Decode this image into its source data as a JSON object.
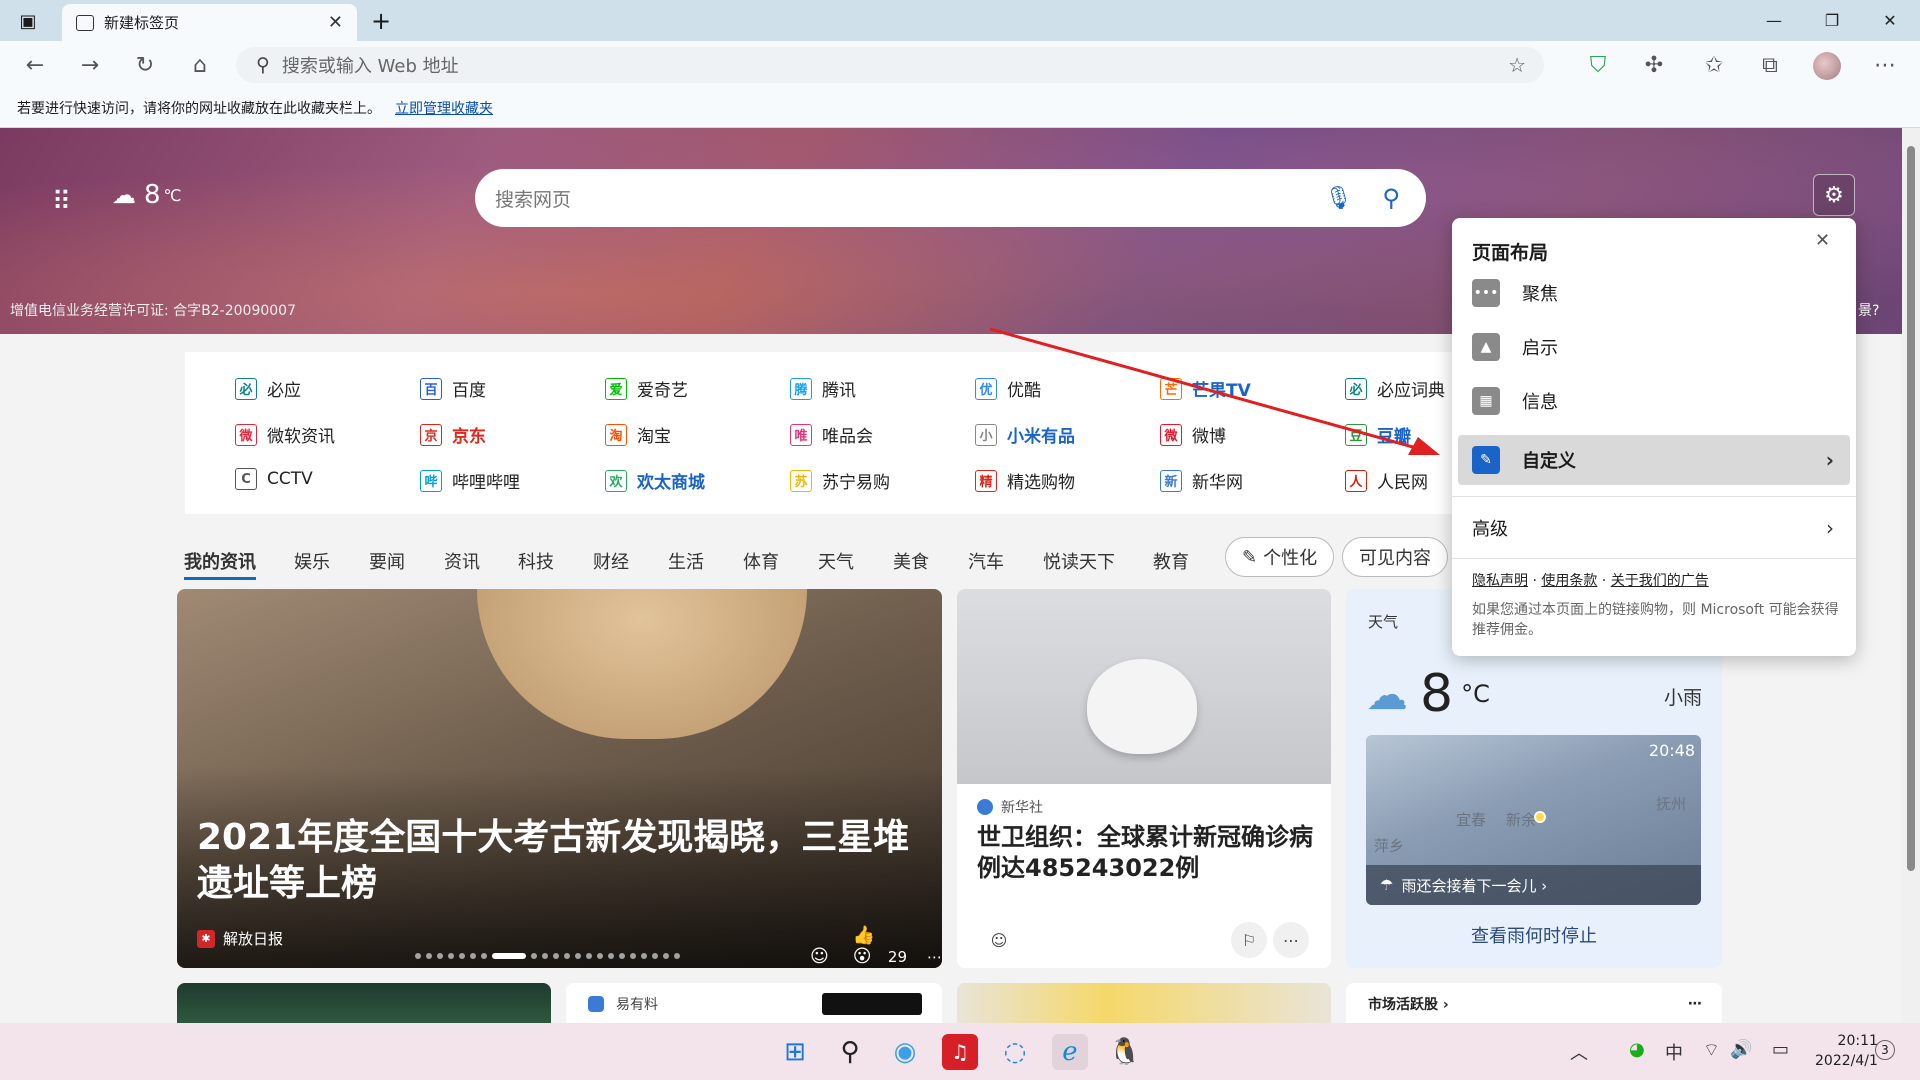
{
  "browser": {
    "tab_title": "新建标签页",
    "address_placeholder": "搜索或输入 Web 地址",
    "favorites_prompt": "若要进行快速访问，请将你的网址收藏放在此收藏夹栏上。",
    "favorites_link": "立即管理收藏夹"
  },
  "hero": {
    "weather_temp": "8",
    "weather_unit": "℃",
    "search_placeholder": "搜索网页",
    "license": "增值电信业务经营许可证: 合字B2-20090007",
    "tail_text": "景?"
  },
  "quick_links": [
    {
      "label": "必应",
      "icon": "bing-icon",
      "color": "#0c8484"
    },
    {
      "label": "百度",
      "icon": "baidu-icon",
      "color": "#2b5dd6"
    },
    {
      "label": "爱奇艺",
      "icon": "iqiyi-icon",
      "color": "#00be06"
    },
    {
      "label": "腾讯",
      "icon": "tencent-icon",
      "color": "#19a0e6"
    },
    {
      "label": "优酷",
      "icon": "youku-icon",
      "color": "#2d8bff"
    },
    {
      "label": "芒果TV",
      "icon": "mgtv-icon",
      "color": "#ff6a00"
    },
    {
      "label": "必应词典",
      "icon": "bing-dict-icon",
      "color": "#0c8484"
    },
    {
      "label": "微软资讯",
      "icon": "msn-icon",
      "color": "#e3273d"
    },
    {
      "label": "京东",
      "icon": "jd-icon",
      "color": "#e1251b"
    },
    {
      "label": "淘宝",
      "icon": "taobao-icon",
      "color": "#ff5000"
    },
    {
      "label": "唯品会",
      "icon": "vip-icon",
      "color": "#e7337a"
    },
    {
      "label": "小米有品",
      "icon": "youpin-icon",
      "color": "#888888"
    },
    {
      "label": "微博",
      "icon": "weibo-icon",
      "color": "#e6162d"
    },
    {
      "label": "豆瓣",
      "icon": "douban-icon",
      "color": "#2e963d"
    },
    {
      "label": "CCTV",
      "icon": "cctv-icon",
      "color": "#555555"
    },
    {
      "label": "哔哩哔哩",
      "icon": "bilibili-icon",
      "color": "#00a1d6"
    },
    {
      "label": "欢太商城",
      "icon": "heytap-icon",
      "color": "#27ae60"
    },
    {
      "label": "苏宁易购",
      "icon": "suning-icon",
      "color": "#f7b500"
    },
    {
      "label": "精选购物",
      "icon": "shopping-icon",
      "color": "#e1251b"
    },
    {
      "label": "新华网",
      "icon": "xinhua-icon",
      "color": "#3a7bd5"
    },
    {
      "label": "人民网",
      "icon": "people-icon",
      "color": "#d81e06"
    }
  ],
  "nav_tabs": [
    "我的资讯",
    "娱乐",
    "要闻",
    "资讯",
    "科技",
    "财经",
    "生活",
    "体育",
    "天气",
    "美食",
    "汽车",
    "悦读天下",
    "教育"
  ],
  "nav_pills": {
    "personalize": "个性化",
    "visible": "可见内容"
  },
  "feature": {
    "title": "2021年度全国十大考古新发现揭晓，三星堆遗址等上榜",
    "source": "解放日报",
    "reactions": "29"
  },
  "news2": {
    "source": "新华社",
    "title": "世卫组织：全球累计新冠确诊病例达485243022例"
  },
  "weather_card": {
    "label": "天气",
    "temp": "8",
    "unit": "°C",
    "condition": "小雨",
    "map_time": "20:48",
    "map_city1": "宜春",
    "map_city2": "新余",
    "map_city3": "抚州",
    "map_city4": "萍乡",
    "rain_notice": "雨还会接着下一会儿 ›",
    "link": "查看雨何时停止"
  },
  "bottom_cards": {
    "card2_source": "易有料",
    "card4_title": "市场活跃股 ›"
  },
  "layout_panel": {
    "title": "页面布局",
    "items": [
      "聚焦",
      "启示",
      "信息",
      "自定义"
    ],
    "advanced": "高级",
    "links": [
      "隐私声明",
      "使用条款",
      "关于我们的广告"
    ],
    "note": "如果您通过本页面上的链接购物，则 Microsoft 可能会获得推荐佣金。"
  },
  "taskbar": {
    "ime": "中",
    "time": "20:11",
    "date": "2022/4/1",
    "notif_count": "3"
  }
}
